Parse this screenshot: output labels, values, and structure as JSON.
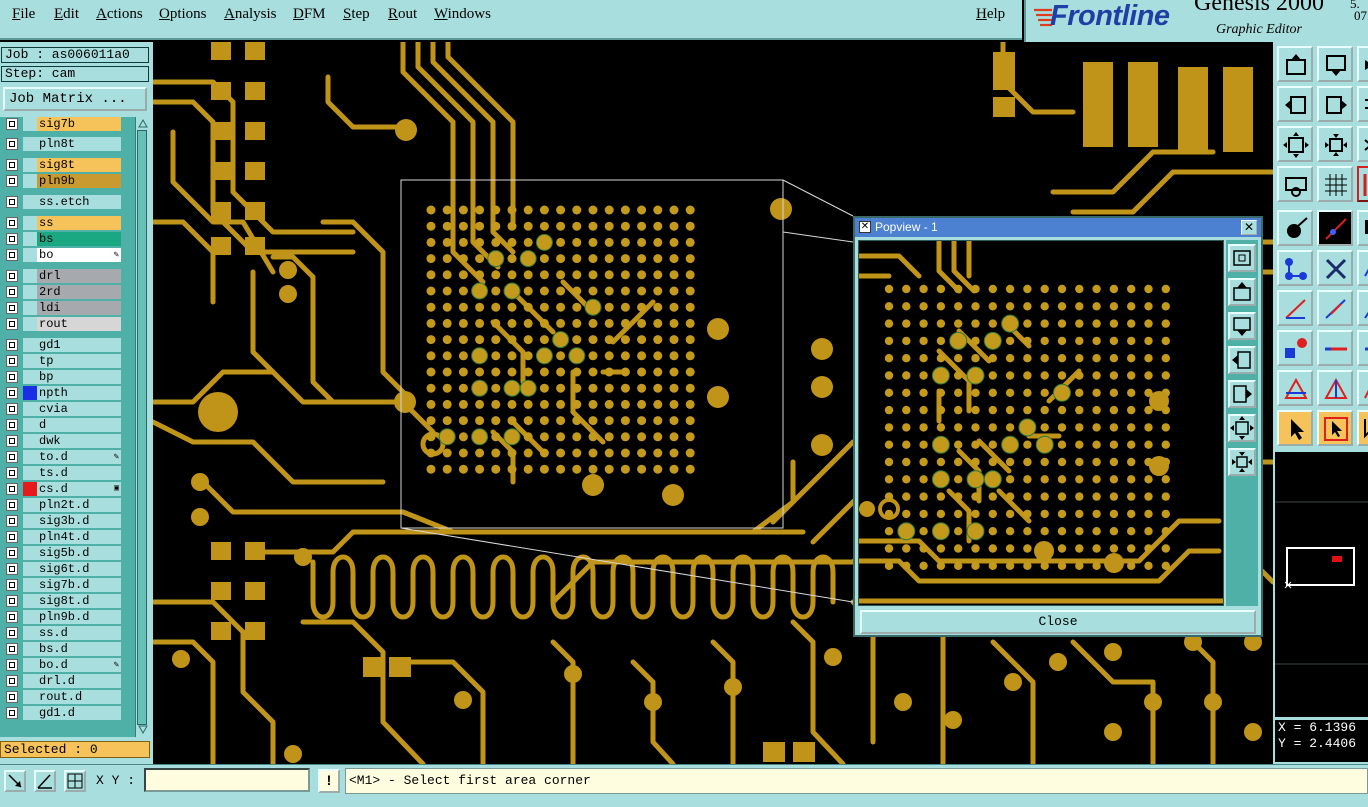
{
  "menu": {
    "items": [
      "File",
      "Edit",
      "Actions",
      "Options",
      "Analysis",
      "DFM",
      "Step",
      "Rout",
      "Windows"
    ],
    "help": "Help"
  },
  "brand": {
    "logo": "Frontline",
    "product": "Genesis 2000",
    "subtitle": "Graphic Editor",
    "version_top": "5.",
    "version_bottom": "07."
  },
  "job": {
    "job_label": "Job : as006011a0",
    "step_label": "Step: cam",
    "job_matrix_button": "Job Matrix ..."
  },
  "layers": [
    {
      "name": "sig7b",
      "color": "#f6c35a",
      "swatch": ""
    },
    {
      "name": "pln8t",
      "color": "#a8dedd",
      "swatch": ""
    },
    {
      "name": "sig8t",
      "color": "#f6c35a",
      "swatch": ""
    },
    {
      "name": "pln9b",
      "color": "#c89a30",
      "swatch": ""
    },
    {
      "name": "ss.etch",
      "color": "#a8dedd",
      "swatch": ""
    },
    {
      "name": "ss",
      "color": "#f6c35a",
      "swatch": ""
    },
    {
      "name": "bs",
      "color": "#1aa882",
      "swatch": ""
    },
    {
      "name": "bo",
      "color": "#ffffff",
      "swatch": ""
    },
    {
      "name": "drl",
      "color": "#a6aaae",
      "swatch": ""
    },
    {
      "name": "2rd",
      "color": "#a6aaae",
      "swatch": ""
    },
    {
      "name": "ldi",
      "color": "#a6aaae",
      "swatch": ""
    },
    {
      "name": "rout",
      "color": "#d6d6d6",
      "swatch": ""
    },
    {
      "name": "gd1",
      "color": "#a8dedd",
      "swatch": ""
    },
    {
      "name": "tp",
      "color": "#a8dedd",
      "swatch": ""
    },
    {
      "name": "bp",
      "color": "#a8dedd",
      "swatch": ""
    },
    {
      "name": "npth",
      "color": "#a8dedd",
      "swatch": "#1a2ee6"
    },
    {
      "name": "cvia",
      "color": "#a8dedd",
      "swatch": ""
    },
    {
      "name": "d",
      "color": "#a8dedd",
      "swatch": ""
    },
    {
      "name": "dwk",
      "color": "#a8dedd",
      "swatch": ""
    },
    {
      "name": "to.d",
      "color": "#a8dedd",
      "swatch": ""
    },
    {
      "name": "ts.d",
      "color": "#a8dedd",
      "swatch": ""
    },
    {
      "name": "cs.d",
      "color": "#a8dedd",
      "swatch": "#e61a1a"
    },
    {
      "name": "pln2t.d",
      "color": "#a8dedd",
      "swatch": ""
    },
    {
      "name": "sig3b.d",
      "color": "#a8dedd",
      "swatch": ""
    },
    {
      "name": "pln4t.d",
      "color": "#a8dedd",
      "swatch": ""
    },
    {
      "name": "sig5b.d",
      "color": "#a8dedd",
      "swatch": ""
    },
    {
      "name": "sig6t.d",
      "color": "#a8dedd",
      "swatch": ""
    },
    {
      "name": "sig7b.d",
      "color": "#a8dedd",
      "swatch": ""
    },
    {
      "name": "sig8t.d",
      "color": "#a8dedd",
      "swatch": ""
    },
    {
      "name": "pln9b.d",
      "color": "#a8dedd",
      "swatch": ""
    },
    {
      "name": "ss.d",
      "color": "#a8dedd",
      "swatch": ""
    },
    {
      "name": "bs.d",
      "color": "#a8dedd",
      "swatch": ""
    },
    {
      "name": "bo.d",
      "color": "#a8dedd",
      "swatch": ""
    },
    {
      "name": "drl.d",
      "color": "#a8dedd",
      "swatch": ""
    },
    {
      "name": "rout.d",
      "color": "#a8dedd",
      "swatch": ""
    },
    {
      "name": "gd1.d",
      "color": "#a8dedd",
      "swatch": ""
    }
  ],
  "selected": "Selected : 0",
  "popview": {
    "title": "Popview - 1",
    "close_label": "Close"
  },
  "coords": {
    "x": "X = 6.1396",
    "y": "Y = 2.4406"
  },
  "status": {
    "xy_label": "X Y :",
    "xy_value": "",
    "warn": "!",
    "prompt": "<M1> - Select first area corner"
  },
  "colors": {
    "copper": "#c09418",
    "panel": "#a8dedd",
    "pad": "#c49a1c"
  }
}
